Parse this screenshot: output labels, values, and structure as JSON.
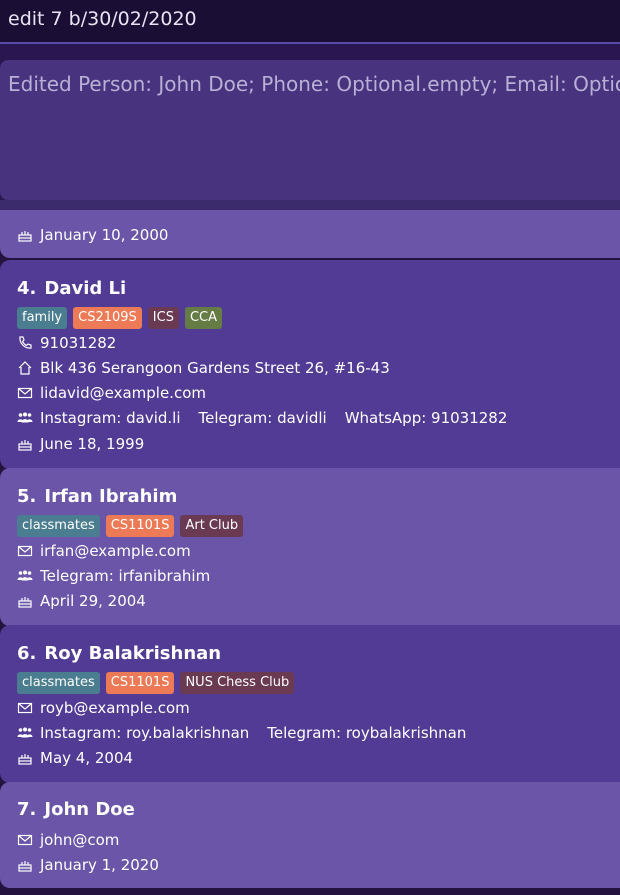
{
  "command_box": {
    "value": "edit 7 b/30/02/2020"
  },
  "result_box": {
    "text": "Edited Person: John Doe; Phone: Optional.empty; Email: Optional[jo"
  },
  "colors": {
    "tag_family": "#4a7a8c",
    "tag_module": "#e8785a",
    "tag_cca": "#6d7a48",
    "tag_club": "#6e3a4e",
    "tag_classmates": "#4a7a8c"
  },
  "persons": [
    {
      "partial": true,
      "birthday": "January 10, 2000"
    },
    {
      "index": "4.",
      "name": "David Li",
      "tags": [
        {
          "label": "family",
          "color": "#4a7d8f"
        },
        {
          "label": "CS2109S",
          "color": "#ec7a56"
        },
        {
          "label": "ICS",
          "color": "#6a3a52"
        },
        {
          "label": "CCA",
          "color": "#667c45"
        }
      ],
      "phone": "91031282",
      "address": "Blk 436 Serangoon Gardens Street 26, #16-43",
      "email": "lidavid@example.com",
      "socials": [
        "Instagram: david.li",
        "Telegram: davidli",
        "WhatsApp: 91031282"
      ],
      "birthday": "June 18, 1999"
    },
    {
      "index": "5.",
      "name": "Irfan Ibrahim",
      "tags": [
        {
          "label": "classmates",
          "color": "#4a7d8f"
        },
        {
          "label": "CS1101S",
          "color": "#ec7a56"
        },
        {
          "label": "Art Club",
          "color": "#6a3a52"
        }
      ],
      "email": "irfan@example.com",
      "socials": [
        "Telegram: irfanibrahim"
      ],
      "birthday": "April 29, 2004"
    },
    {
      "index": "6.",
      "name": "Roy Balakrishnan",
      "tags": [
        {
          "label": "classmates",
          "color": "#4a7d8f"
        },
        {
          "label": "CS1101S",
          "color": "#ec7a56"
        },
        {
          "label": "NUS Chess Club",
          "color": "#6a3a52"
        }
      ],
      "email": "royb@example.com",
      "socials": [
        "Instagram: roy.balakrishnan",
        "Telegram: roybalakrishnan"
      ],
      "birthday": "May 4, 2004"
    },
    {
      "index": "7.",
      "name": "John Doe",
      "email": "john@com",
      "birthday": "January 1, 2020"
    }
  ]
}
